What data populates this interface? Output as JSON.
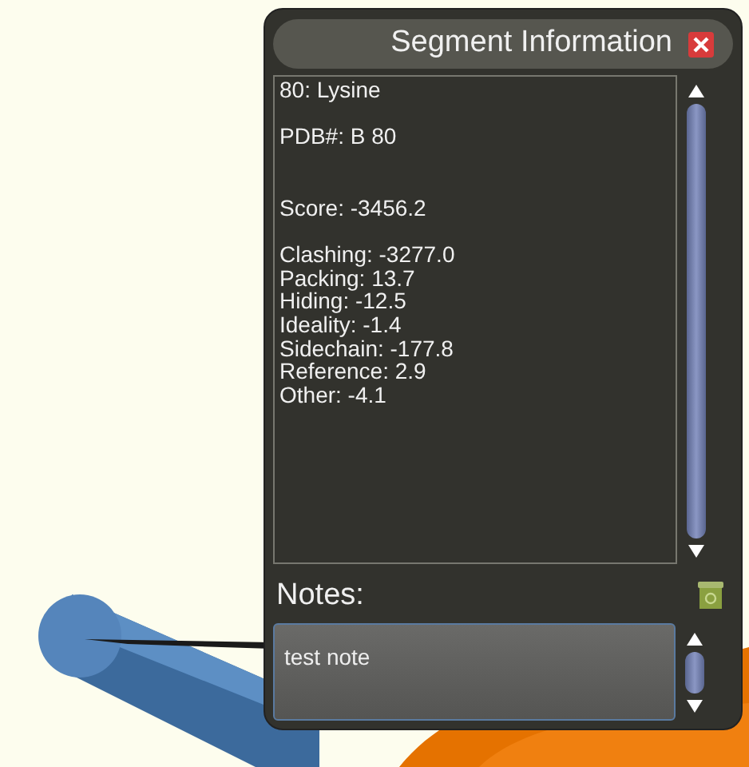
{
  "panel": {
    "title": "Segment Information",
    "info_text": "80: Lysine\n\nPDB#: B 80\n\n\nScore: -3456.2\n\nClashing: -3277.0\nPacking: 13.7\nHiding: -12.5\nIdeality: -1.4\nSidechain: -177.8\nReference: 2.9\nOther: -4.1",
    "notes_label": "Notes:",
    "notes": {
      "value": "test note"
    }
  }
}
